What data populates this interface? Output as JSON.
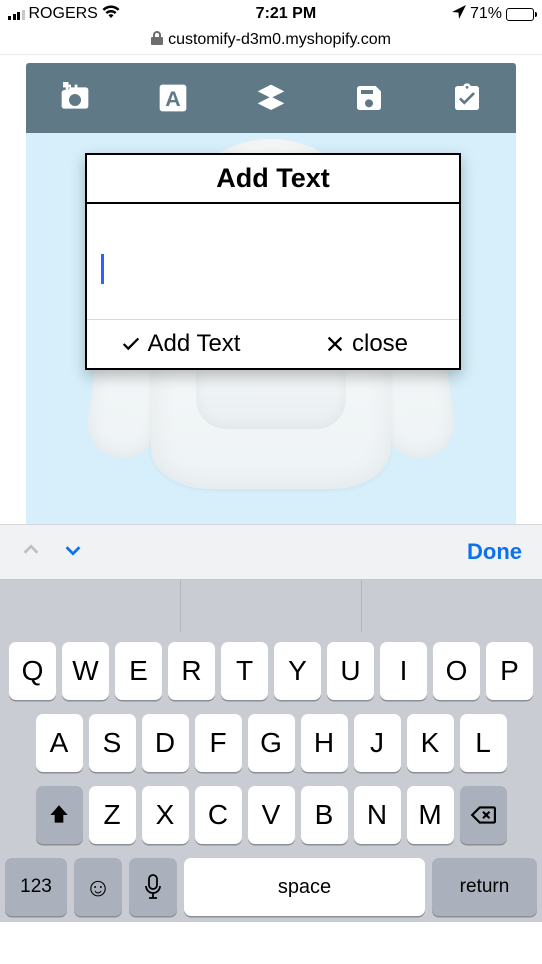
{
  "status": {
    "carrier": "ROGERS",
    "time": "7:21 PM",
    "battery_pct": "71%"
  },
  "url": "customify-d3m0.myshopify.com",
  "modal": {
    "title": "Add Text",
    "input_value": "",
    "add_label": "Add Text",
    "close_label": "close"
  },
  "accessory": {
    "done": "Done"
  },
  "keyboard": {
    "row1": [
      "Q",
      "W",
      "E",
      "R",
      "T",
      "Y",
      "U",
      "I",
      "O",
      "P"
    ],
    "row2": [
      "A",
      "S",
      "D",
      "F",
      "G",
      "H",
      "J",
      "K",
      "L"
    ],
    "row3": [
      "Z",
      "X",
      "C",
      "V",
      "B",
      "N",
      "M"
    ],
    "numkey": "123",
    "space": "space",
    "return": "return"
  }
}
